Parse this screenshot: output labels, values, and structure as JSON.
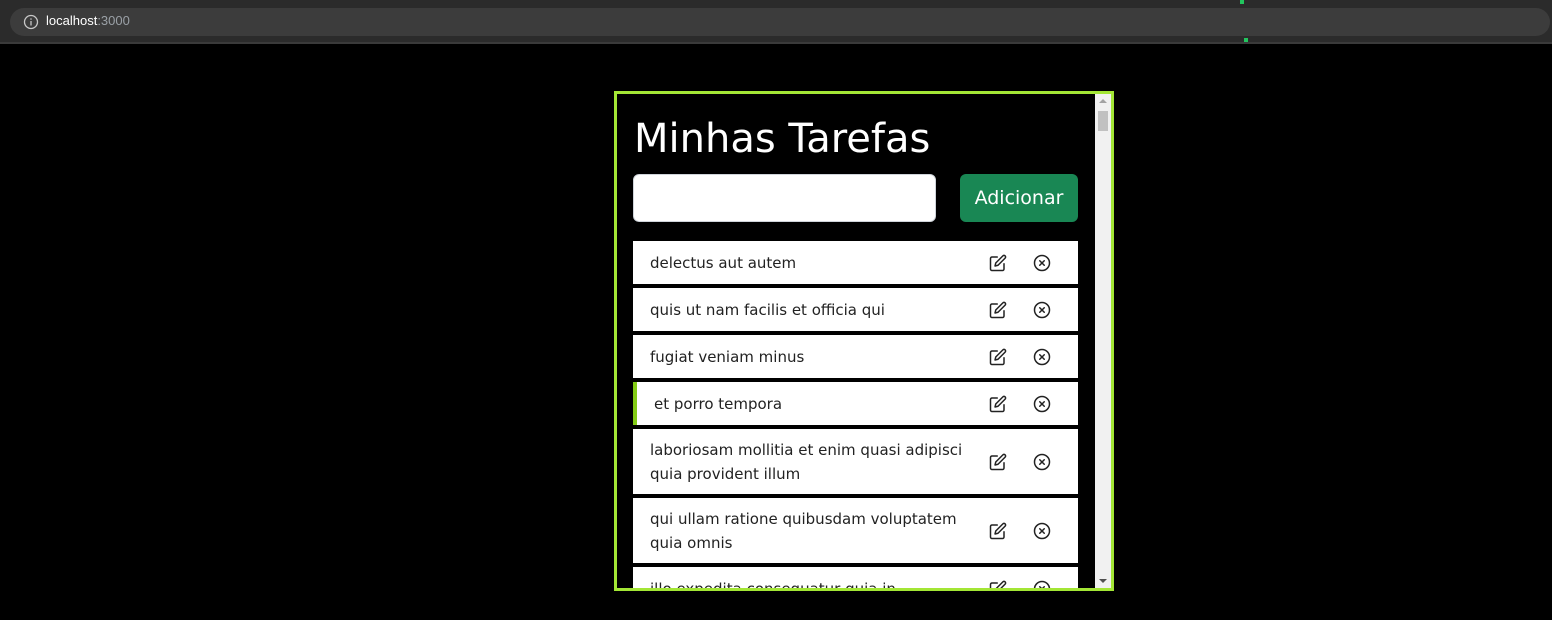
{
  "browser": {
    "url_host": "localhost",
    "url_port": ":3000"
  },
  "app": {
    "title": "Minhas Tarefas",
    "input": {
      "value": "",
      "placeholder": ""
    },
    "add_button_label": "Adicionar",
    "tasks": [
      {
        "text": "delectus aut autem",
        "edit_icon": "edit-icon",
        "delete_icon": "close-circle-icon"
      },
      {
        "text": "quis ut nam facilis et officia qui",
        "edit_icon": "edit-icon",
        "delete_icon": "close-circle-icon"
      },
      {
        "text": "fugiat veniam minus",
        "edit_icon": "edit-icon",
        "delete_icon": "close-circle-icon"
      },
      {
        "text": "et porro tempora",
        "edit_icon": "edit-icon",
        "delete_icon": "close-circle-icon"
      },
      {
        "text": "laboriosam mollitia et enim quasi adipisci quia provident illum",
        "edit_icon": "edit-icon",
        "delete_icon": "close-circle-icon"
      },
      {
        "text": "qui ullam ratione quibusdam voluptatem quia omnis",
        "edit_icon": "edit-icon",
        "delete_icon": "close-circle-icon"
      },
      {
        "text": "illo expedita consequatur quia in",
        "edit_icon": "edit-icon",
        "delete_icon": "close-circle-icon"
      }
    ]
  },
  "colors": {
    "frame_border": "#a3e635",
    "add_button": "#198754",
    "active_task_marker": "#84cc16",
    "background": "#000000"
  }
}
